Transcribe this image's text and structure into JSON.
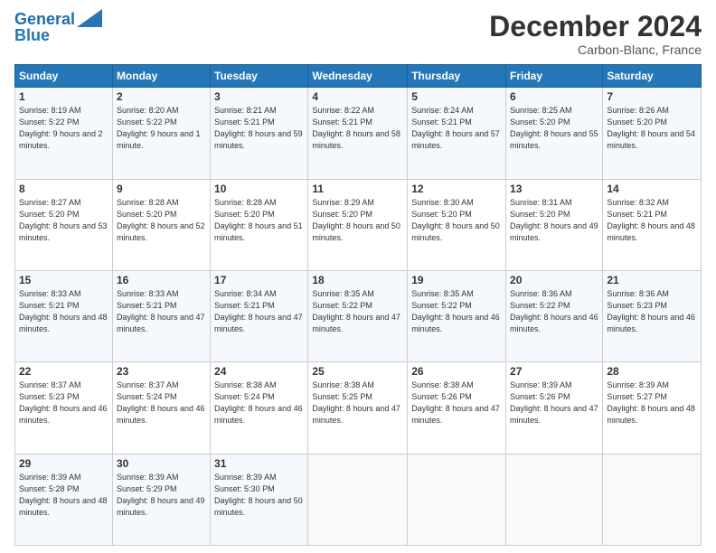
{
  "logo": {
    "line1": "General",
    "line2": "Blue"
  },
  "header": {
    "title": "December 2024",
    "subtitle": "Carbon-Blanc, France"
  },
  "weekdays": [
    "Sunday",
    "Monday",
    "Tuesday",
    "Wednesday",
    "Thursday",
    "Friday",
    "Saturday"
  ],
  "weeks": [
    [
      {
        "day": "1",
        "sunrise": "8:19 AM",
        "sunset": "5:22 PM",
        "daylight": "9 hours and 2 minutes."
      },
      {
        "day": "2",
        "sunrise": "8:20 AM",
        "sunset": "5:22 PM",
        "daylight": "9 hours and 1 minute."
      },
      {
        "day": "3",
        "sunrise": "8:21 AM",
        "sunset": "5:21 PM",
        "daylight": "8 hours and 59 minutes."
      },
      {
        "day": "4",
        "sunrise": "8:22 AM",
        "sunset": "5:21 PM",
        "daylight": "8 hours and 58 minutes."
      },
      {
        "day": "5",
        "sunrise": "8:24 AM",
        "sunset": "5:21 PM",
        "daylight": "8 hours and 57 minutes."
      },
      {
        "day": "6",
        "sunrise": "8:25 AM",
        "sunset": "5:20 PM",
        "daylight": "8 hours and 55 minutes."
      },
      {
        "day": "7",
        "sunrise": "8:26 AM",
        "sunset": "5:20 PM",
        "daylight": "8 hours and 54 minutes."
      }
    ],
    [
      {
        "day": "8",
        "sunrise": "8:27 AM",
        "sunset": "5:20 PM",
        "daylight": "8 hours and 53 minutes."
      },
      {
        "day": "9",
        "sunrise": "8:28 AM",
        "sunset": "5:20 PM",
        "daylight": "8 hours and 52 minutes."
      },
      {
        "day": "10",
        "sunrise": "8:28 AM",
        "sunset": "5:20 PM",
        "daylight": "8 hours and 51 minutes."
      },
      {
        "day": "11",
        "sunrise": "8:29 AM",
        "sunset": "5:20 PM",
        "daylight": "8 hours and 50 minutes."
      },
      {
        "day": "12",
        "sunrise": "8:30 AM",
        "sunset": "5:20 PM",
        "daylight": "8 hours and 50 minutes."
      },
      {
        "day": "13",
        "sunrise": "8:31 AM",
        "sunset": "5:20 PM",
        "daylight": "8 hours and 49 minutes."
      },
      {
        "day": "14",
        "sunrise": "8:32 AM",
        "sunset": "5:21 PM",
        "daylight": "8 hours and 48 minutes."
      }
    ],
    [
      {
        "day": "15",
        "sunrise": "8:33 AM",
        "sunset": "5:21 PM",
        "daylight": "8 hours and 48 minutes."
      },
      {
        "day": "16",
        "sunrise": "8:33 AM",
        "sunset": "5:21 PM",
        "daylight": "8 hours and 47 minutes."
      },
      {
        "day": "17",
        "sunrise": "8:34 AM",
        "sunset": "5:21 PM",
        "daylight": "8 hours and 47 minutes."
      },
      {
        "day": "18",
        "sunrise": "8:35 AM",
        "sunset": "5:22 PM",
        "daylight": "8 hours and 47 minutes."
      },
      {
        "day": "19",
        "sunrise": "8:35 AM",
        "sunset": "5:22 PM",
        "daylight": "8 hours and 46 minutes."
      },
      {
        "day": "20",
        "sunrise": "8:36 AM",
        "sunset": "5:22 PM",
        "daylight": "8 hours and 46 minutes."
      },
      {
        "day": "21",
        "sunrise": "8:36 AM",
        "sunset": "5:23 PM",
        "daylight": "8 hours and 46 minutes."
      }
    ],
    [
      {
        "day": "22",
        "sunrise": "8:37 AM",
        "sunset": "5:23 PM",
        "daylight": "8 hours and 46 minutes."
      },
      {
        "day": "23",
        "sunrise": "8:37 AM",
        "sunset": "5:24 PM",
        "daylight": "8 hours and 46 minutes."
      },
      {
        "day": "24",
        "sunrise": "8:38 AM",
        "sunset": "5:24 PM",
        "daylight": "8 hours and 46 minutes."
      },
      {
        "day": "25",
        "sunrise": "8:38 AM",
        "sunset": "5:25 PM",
        "daylight": "8 hours and 47 minutes."
      },
      {
        "day": "26",
        "sunrise": "8:38 AM",
        "sunset": "5:26 PM",
        "daylight": "8 hours and 47 minutes."
      },
      {
        "day": "27",
        "sunrise": "8:39 AM",
        "sunset": "5:26 PM",
        "daylight": "8 hours and 47 minutes."
      },
      {
        "day": "28",
        "sunrise": "8:39 AM",
        "sunset": "5:27 PM",
        "daylight": "8 hours and 48 minutes."
      }
    ],
    [
      {
        "day": "29",
        "sunrise": "8:39 AM",
        "sunset": "5:28 PM",
        "daylight": "8 hours and 48 minutes."
      },
      {
        "day": "30",
        "sunrise": "8:39 AM",
        "sunset": "5:29 PM",
        "daylight": "8 hours and 49 minutes."
      },
      {
        "day": "31",
        "sunrise": "8:39 AM",
        "sunset": "5:30 PM",
        "daylight": "8 hours and 50 minutes."
      },
      null,
      null,
      null,
      null
    ]
  ]
}
